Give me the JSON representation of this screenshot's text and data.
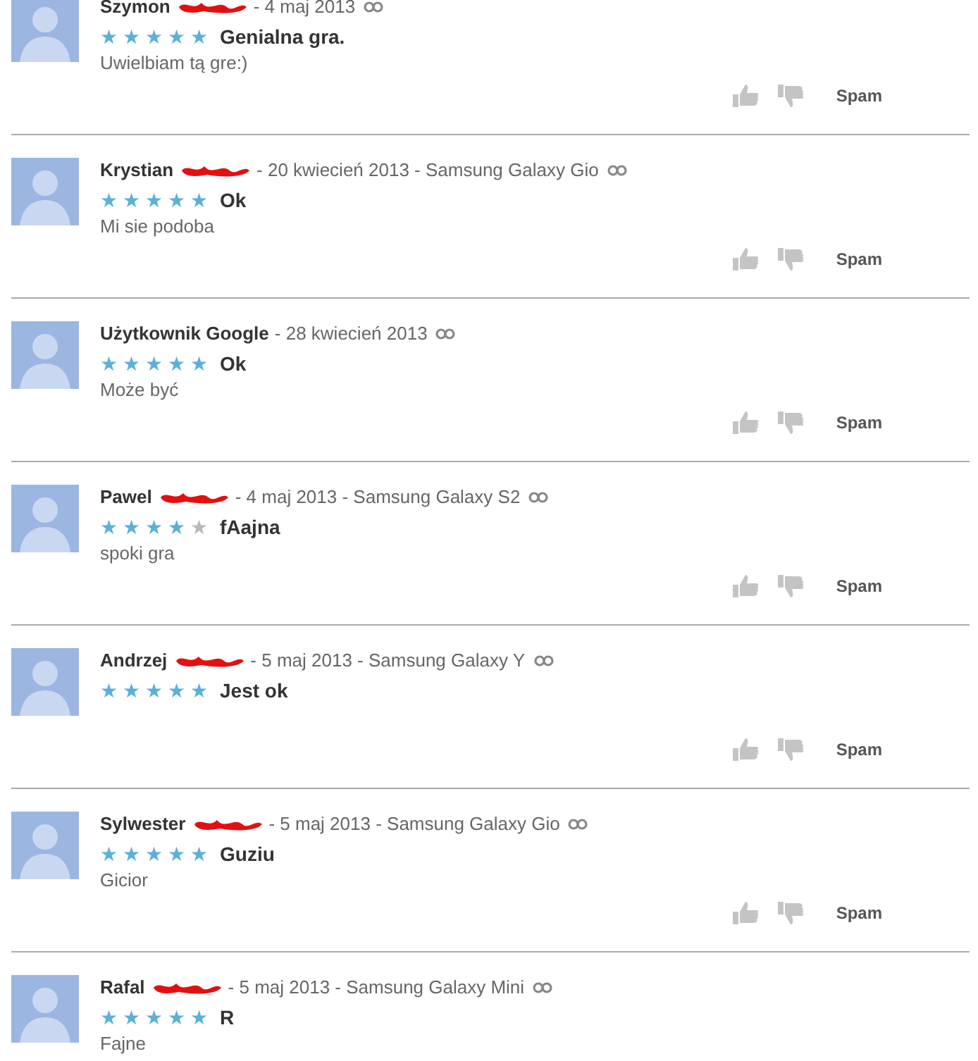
{
  "reviews": [
    {
      "author": "Szymon",
      "redacted": true,
      "meta": "- 4 maj 2013",
      "stars": 5,
      "title": "Genialna gra.",
      "body": "Uwielbiam tą gre:)",
      "spam": "Spam"
    },
    {
      "author": "Krystian",
      "redacted": true,
      "meta": "- 20 kwiecień 2013 - Samsung Galaxy Gio",
      "stars": 5,
      "title": "Ok",
      "body": "Mi sie podoba",
      "spam": "Spam"
    },
    {
      "author": "Użytkownik Google",
      "redacted": false,
      "meta": "- 28 kwiecień 2013",
      "stars": 5,
      "title": "Ok",
      "body": "Może być",
      "spam": "Spam"
    },
    {
      "author": "Pawel",
      "redacted": true,
      "meta": "- 4 maj 2013 - Samsung Galaxy S2",
      "stars": 4,
      "title": "fAajna",
      "body": "spoki gra",
      "spam": "Spam"
    },
    {
      "author": "Andrzej",
      "redacted": true,
      "meta": "- 5 maj 2013 - Samsung Galaxy Y",
      "stars": 5,
      "title": "Jest ok",
      "spam": "Spam"
    },
    {
      "author": "Sylwester",
      "redacted": true,
      "meta": "- 5 maj 2013 - Samsung Galaxy Gio",
      "stars": 5,
      "title": "Guziu",
      "body": "Gicior",
      "spam": "Spam"
    },
    {
      "author": "Rafal",
      "redacted": true,
      "meta": "- 5 maj 2013 - Samsung Galaxy Mini",
      "stars": 5,
      "title": "R",
      "body": "Fajne"
    }
  ]
}
